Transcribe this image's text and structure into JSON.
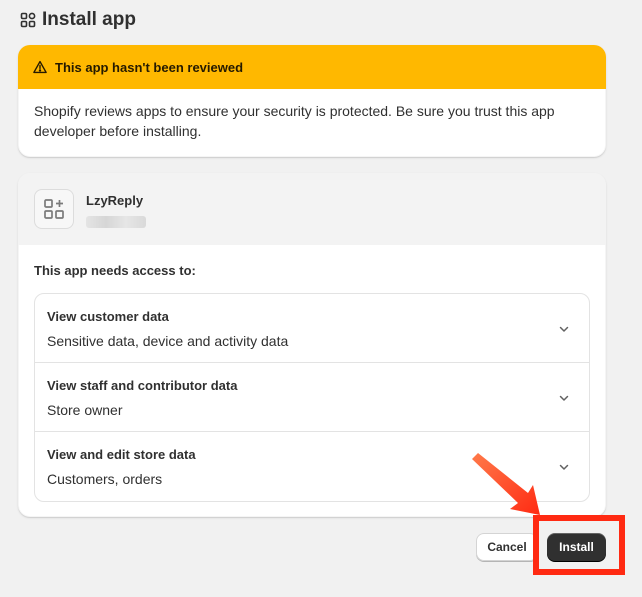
{
  "header": {
    "title": "Install app",
    "icon": "apps-icon"
  },
  "warning": {
    "title": "This app hasn't been reviewed",
    "body": "Shopify reviews apps to ensure your security is protected. Be sure you trust this app developer before installing.",
    "color": "#ffb800",
    "icon": "alert-triangle-icon"
  },
  "app": {
    "name": "LzyReply",
    "logo_icon": "apps-plus-icon",
    "access_title": "This app needs access to:",
    "permissions": [
      {
        "title": "View customer data",
        "desc": "Sensitive data, device and activity data"
      },
      {
        "title": "View staff and contributor data",
        "desc": "Store owner"
      },
      {
        "title": "View and edit store data",
        "desc": "Customers, orders"
      }
    ]
  },
  "actions": {
    "cancel_label": "Cancel",
    "install_label": "Install",
    "primary_color": "#303030"
  },
  "annotation": {
    "highlight_color": "#ff2a12"
  }
}
